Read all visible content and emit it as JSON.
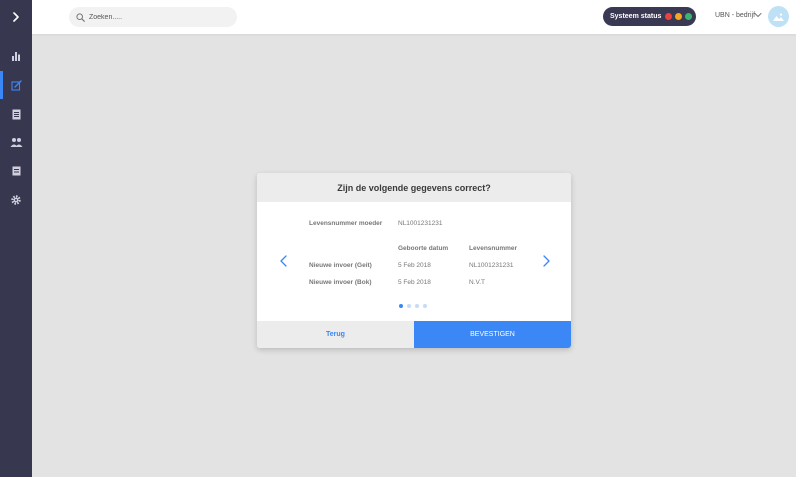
{
  "search": {
    "placeholder": "Zoeken....."
  },
  "system_status": {
    "label": "Systeem status",
    "lights": [
      "#e8433f",
      "#f5a623",
      "#3cb371"
    ]
  },
  "company": {
    "name": "UBN - bedrijf"
  },
  "sidebar": {
    "items": [
      {
        "icon": "bar-chart-icon"
      },
      {
        "icon": "edit-icon",
        "active": true
      },
      {
        "icon": "document-icon"
      },
      {
        "icon": "users-icon"
      },
      {
        "icon": "list-icon"
      },
      {
        "icon": "gear-icon"
      }
    ]
  },
  "modal": {
    "title": "Zijn de volgende gegevens correct?",
    "mother_label": "Levensnummer moeder",
    "mother_value": "NL1001231231",
    "col_birth_date": "Geboorte datum",
    "col_life_number": "Levensnummer",
    "rows": [
      {
        "label": "Nieuwe invoer (Geit)",
        "date": "5 Feb 2018",
        "number": "NL1001231231"
      },
      {
        "label": "Nieuwe invoer (Bok)",
        "date": "5 Feb 2018",
        "number": "N.V.T"
      }
    ],
    "pager": {
      "total": 4,
      "active": 1
    },
    "back_label": "Terug",
    "confirm_label": "BEVESTIGEN"
  },
  "colors": {
    "accent": "#3b87f5",
    "sidebar_bg": "#383750",
    "status_pill_bg": "#3a3953"
  }
}
